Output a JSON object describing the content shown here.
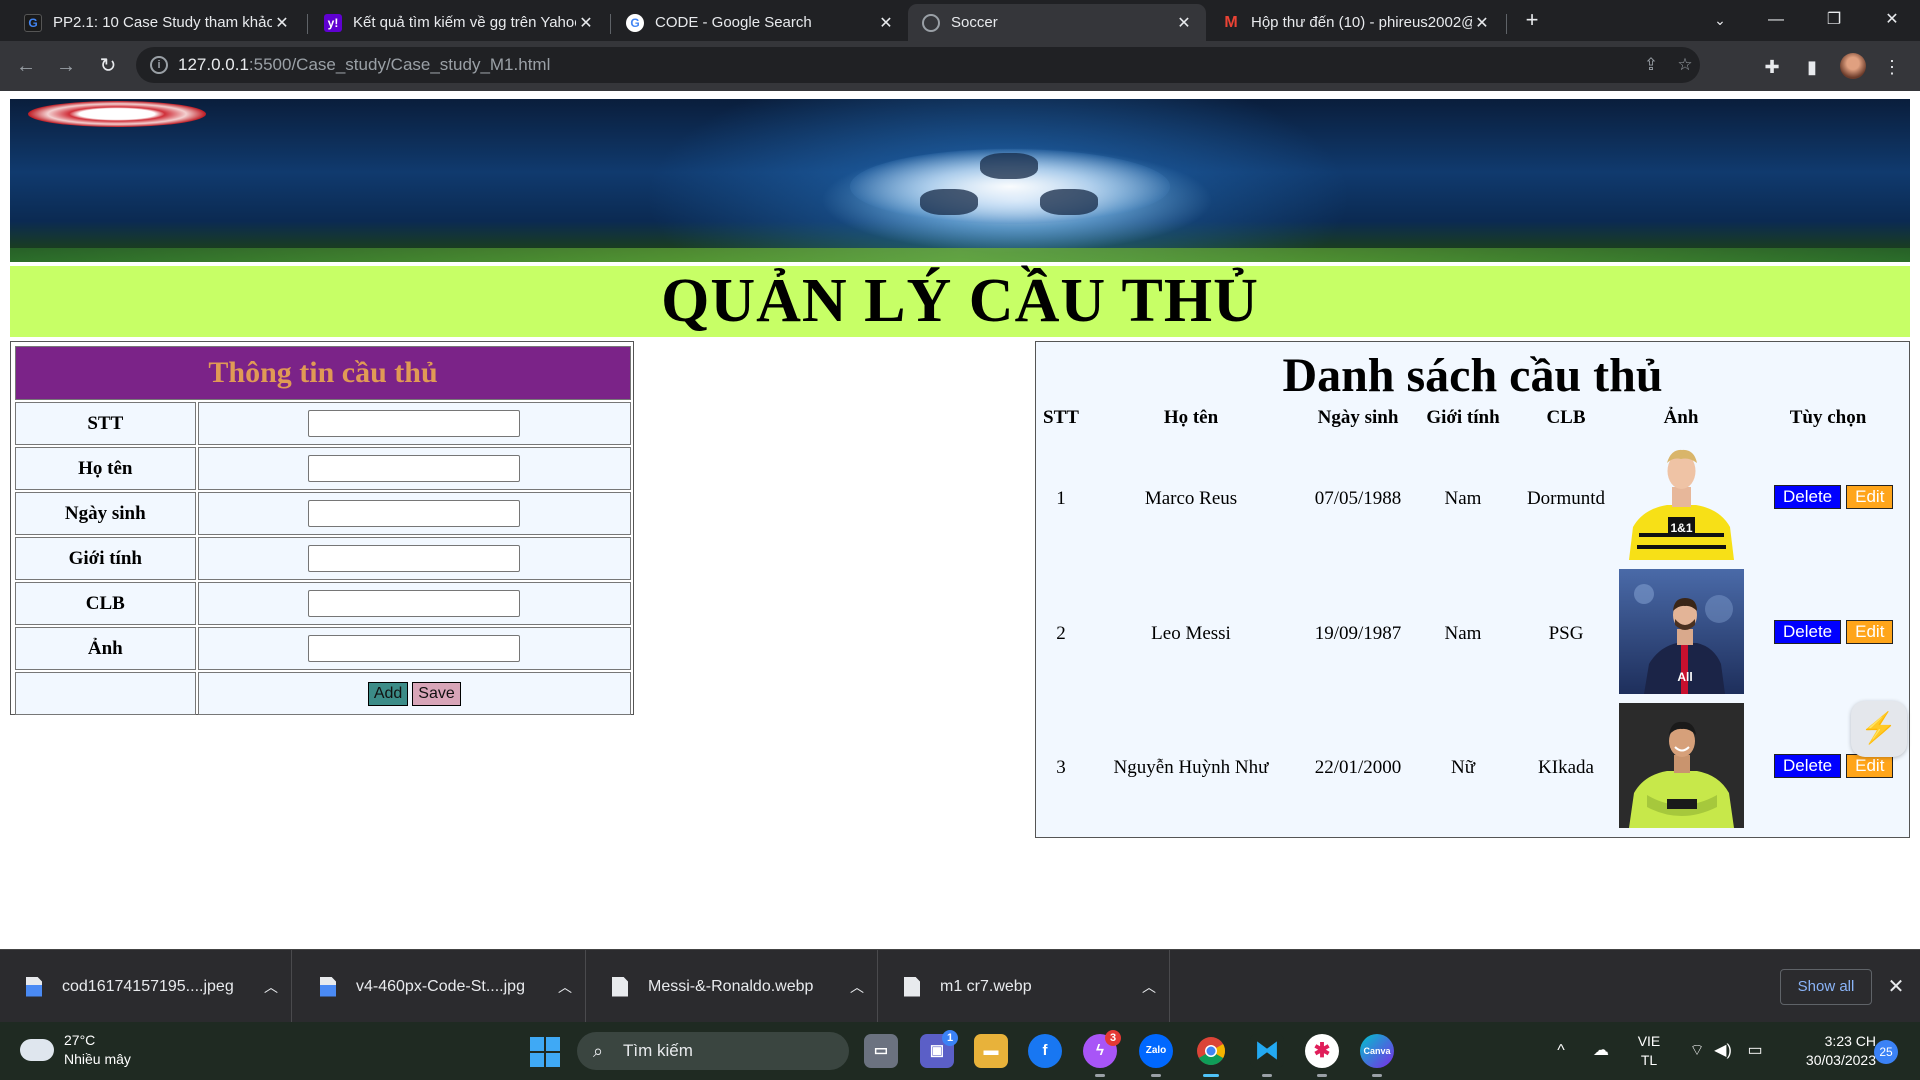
{
  "browser": {
    "tabs": [
      {
        "label": "PP2.1: 10 Case Study tham khảo",
        "favicon": "g-icon",
        "active": false
      },
      {
        "label": "Kết quả tìm kiếm về gg trên Yahoo",
        "favicon": "yahoo-icon",
        "active": false
      },
      {
        "label": "CODE - Google Search",
        "favicon": "google-icon",
        "active": false
      },
      {
        "label": "Soccer",
        "favicon": "globe-icon",
        "active": true
      },
      {
        "label": "Hộp thư đến (10) - phireus2002@",
        "favicon": "gmail-icon",
        "active": false
      }
    ],
    "new_tab": "+",
    "url_host": "127.0.0.1",
    "url_path": ":5500/Case_study/Case_study_M1.html"
  },
  "page": {
    "title": "QUẢN LÝ CẦU THỦ",
    "form": {
      "heading": "Thông tin cầu thủ",
      "fields": [
        {
          "label": "STT",
          "value": ""
        },
        {
          "label": "Họ tên",
          "value": ""
        },
        {
          "label": "Ngày sinh",
          "value": ""
        },
        {
          "label": "Giới tính",
          "value": ""
        },
        {
          "label": "CLB",
          "value": ""
        },
        {
          "label": "Ảnh",
          "value": ""
        }
      ],
      "add_label": "Add",
      "save_label": "Save"
    },
    "list": {
      "heading": "Danh sách cầu thủ",
      "columns": [
        "STT",
        "Họ tên",
        "Ngày sinh",
        "Giới tính",
        "CLB",
        "Ảnh",
        "Tùy chọn"
      ],
      "rows": [
        {
          "stt": "1",
          "name": "Marco Reus",
          "dob": "07/05/1988",
          "gender": "Nam",
          "club": "Dormuntd",
          "photo": "player-photo-reus",
          "jersey_text": "1&1"
        },
        {
          "stt": "2",
          "name": "Leo Messi",
          "dob": "19/09/1987",
          "gender": "Nam",
          "club": "PSG",
          "photo": "player-photo-messi",
          "jersey_text": "All"
        },
        {
          "stt": "3",
          "name": "Nguyễn Huỳnh Như",
          "dob": "22/01/2000",
          "gender": "Nữ",
          "club": "KIkada",
          "photo": "player-photo-nhu",
          "jersey_text": ""
        }
      ],
      "delete_label": "Delete",
      "edit_label": "Edit"
    }
  },
  "downloads": {
    "items": [
      {
        "name": "cod16174157195....jpeg",
        "type": "image"
      },
      {
        "name": "v4-460px-Code-St....jpg",
        "type": "image"
      },
      {
        "name": "Messi-&-Ronaldo.webp",
        "type": "file"
      },
      {
        "name": "m1 cr7.webp",
        "type": "file"
      }
    ],
    "show_all": "Show all",
    "close": "✕"
  },
  "taskbar": {
    "temperature": "27°C",
    "weather": "Nhiều mây",
    "search_placeholder": "Tìm kiếm",
    "badges": {
      "chat": "1",
      "messenger": "3"
    },
    "lang_line1": "VIE",
    "lang_line2": "TL",
    "time": "3:23 CH",
    "date": "30/03/2023",
    "notifications": "25"
  },
  "colors": {
    "title_strip": "#c7ff66",
    "form_header_bg": "#7b2388",
    "form_header_text": "#e09a55",
    "delete_button": "#0000ff",
    "edit_button": "#ffa51a",
    "add_button": "#3c8c88",
    "save_button": "#d8a5b8"
  }
}
